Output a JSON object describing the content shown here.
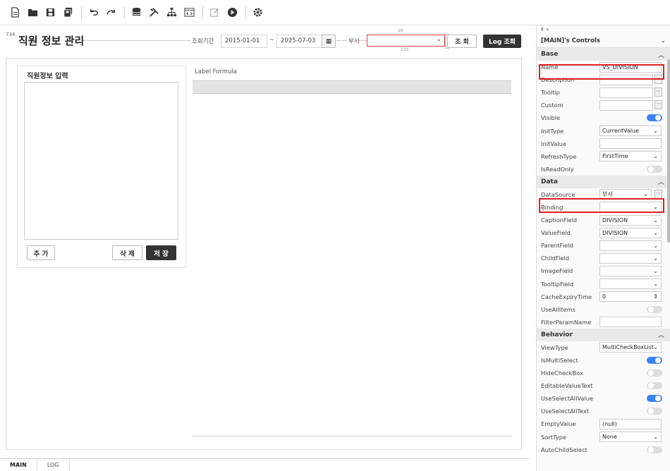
{
  "toolbar": {
    "icons": [
      "new-doc-icon",
      "open-folder-icon",
      "save-icon",
      "save-all-icon",
      "undo-icon",
      "redo-icon",
      "database-icon",
      "tools-icon",
      "hierarchy-icon",
      "source-code-icon",
      "edit-icon",
      "run-icon",
      "settings-icon"
    ]
  },
  "header": {
    "number": "734",
    "title": "직원 정보 관리",
    "period_label": "조회기간",
    "date_from": "2015-01-01",
    "tilde": "~",
    "date_to": "2025-07-03",
    "dept_label": "부서",
    "dim_top": "10",
    "dim_bottom": "155",
    "query_btn": "조 회",
    "log_btn": "Log 조회"
  },
  "form": {
    "title": "직원정보 입력",
    "add": "추 가",
    "delete": "삭 제",
    "save": "저 장"
  },
  "grid": {
    "label": "Label Formula"
  },
  "tabs": [
    "MAIN",
    "LOG"
  ],
  "props": {
    "top": "⇞ »",
    "controls_title": "[MAIN]'s Controls",
    "base_label": "Base",
    "base": [
      {
        "name": "Name",
        "value": "VS_DIVISION",
        "type": "text"
      },
      {
        "name": "Description",
        "value": "",
        "type": "more"
      },
      {
        "name": "Tooltip",
        "value": "",
        "type": "more"
      },
      {
        "name": "Custom",
        "value": "",
        "type": "more"
      },
      {
        "name": "Visible",
        "value": "",
        "type": "toggle",
        "on": true
      },
      {
        "name": "InitType",
        "value": "CurrentValue",
        "type": "select"
      },
      {
        "name": "InitValue",
        "value": "",
        "type": "text"
      },
      {
        "name": "RefreshType",
        "value": "FirstTime",
        "type": "select"
      },
      {
        "name": "IsReadOnly",
        "value": "",
        "type": "toggle",
        "on": false
      }
    ],
    "data_label": "Data",
    "data": [
      {
        "name": "DataSource",
        "value": "부서",
        "type": "selectmore"
      },
      {
        "name": "Binding",
        "value": "",
        "type": "select"
      },
      {
        "name": "CaptionField",
        "value": "DIVISION",
        "type": "select"
      },
      {
        "name": "ValueField",
        "value": "DIVISION",
        "type": "select"
      },
      {
        "name": "ParentField",
        "value": "",
        "type": "select"
      },
      {
        "name": "ChildField",
        "value": "",
        "type": "select"
      },
      {
        "name": "ImageField",
        "value": "",
        "type": "select"
      },
      {
        "name": "TooltipField",
        "value": "",
        "type": "select"
      },
      {
        "name": "CacheExpiryTime",
        "value": "0",
        "type": "spin"
      },
      {
        "name": "UseAllItems",
        "value": "",
        "type": "toggle",
        "on": false
      },
      {
        "name": "FilterParamName",
        "value": "",
        "type": "text"
      }
    ],
    "behavior_label": "Behavior",
    "behavior": [
      {
        "name": "ViewType",
        "value": "MultiCheckBoxList",
        "type": "select"
      },
      {
        "name": "IsMultiSelect",
        "value": "",
        "type": "toggle",
        "on": true
      },
      {
        "name": "HideCheckBox",
        "value": "",
        "type": "toggle",
        "on": false
      },
      {
        "name": "EditableValueText",
        "value": "",
        "type": "toggle",
        "on": false
      },
      {
        "name": "UseSelectAllValue",
        "value": "",
        "type": "toggle",
        "on": true
      },
      {
        "name": "UseSelectAllText",
        "value": "",
        "type": "toggle",
        "on": false
      },
      {
        "name": "EmptyValue",
        "value": "(null)",
        "type": "text"
      },
      {
        "name": "SortType",
        "value": "None",
        "type": "select"
      },
      {
        "name": "AutoChildSelect",
        "value": "",
        "type": "toggle",
        "on": false
      }
    ]
  }
}
